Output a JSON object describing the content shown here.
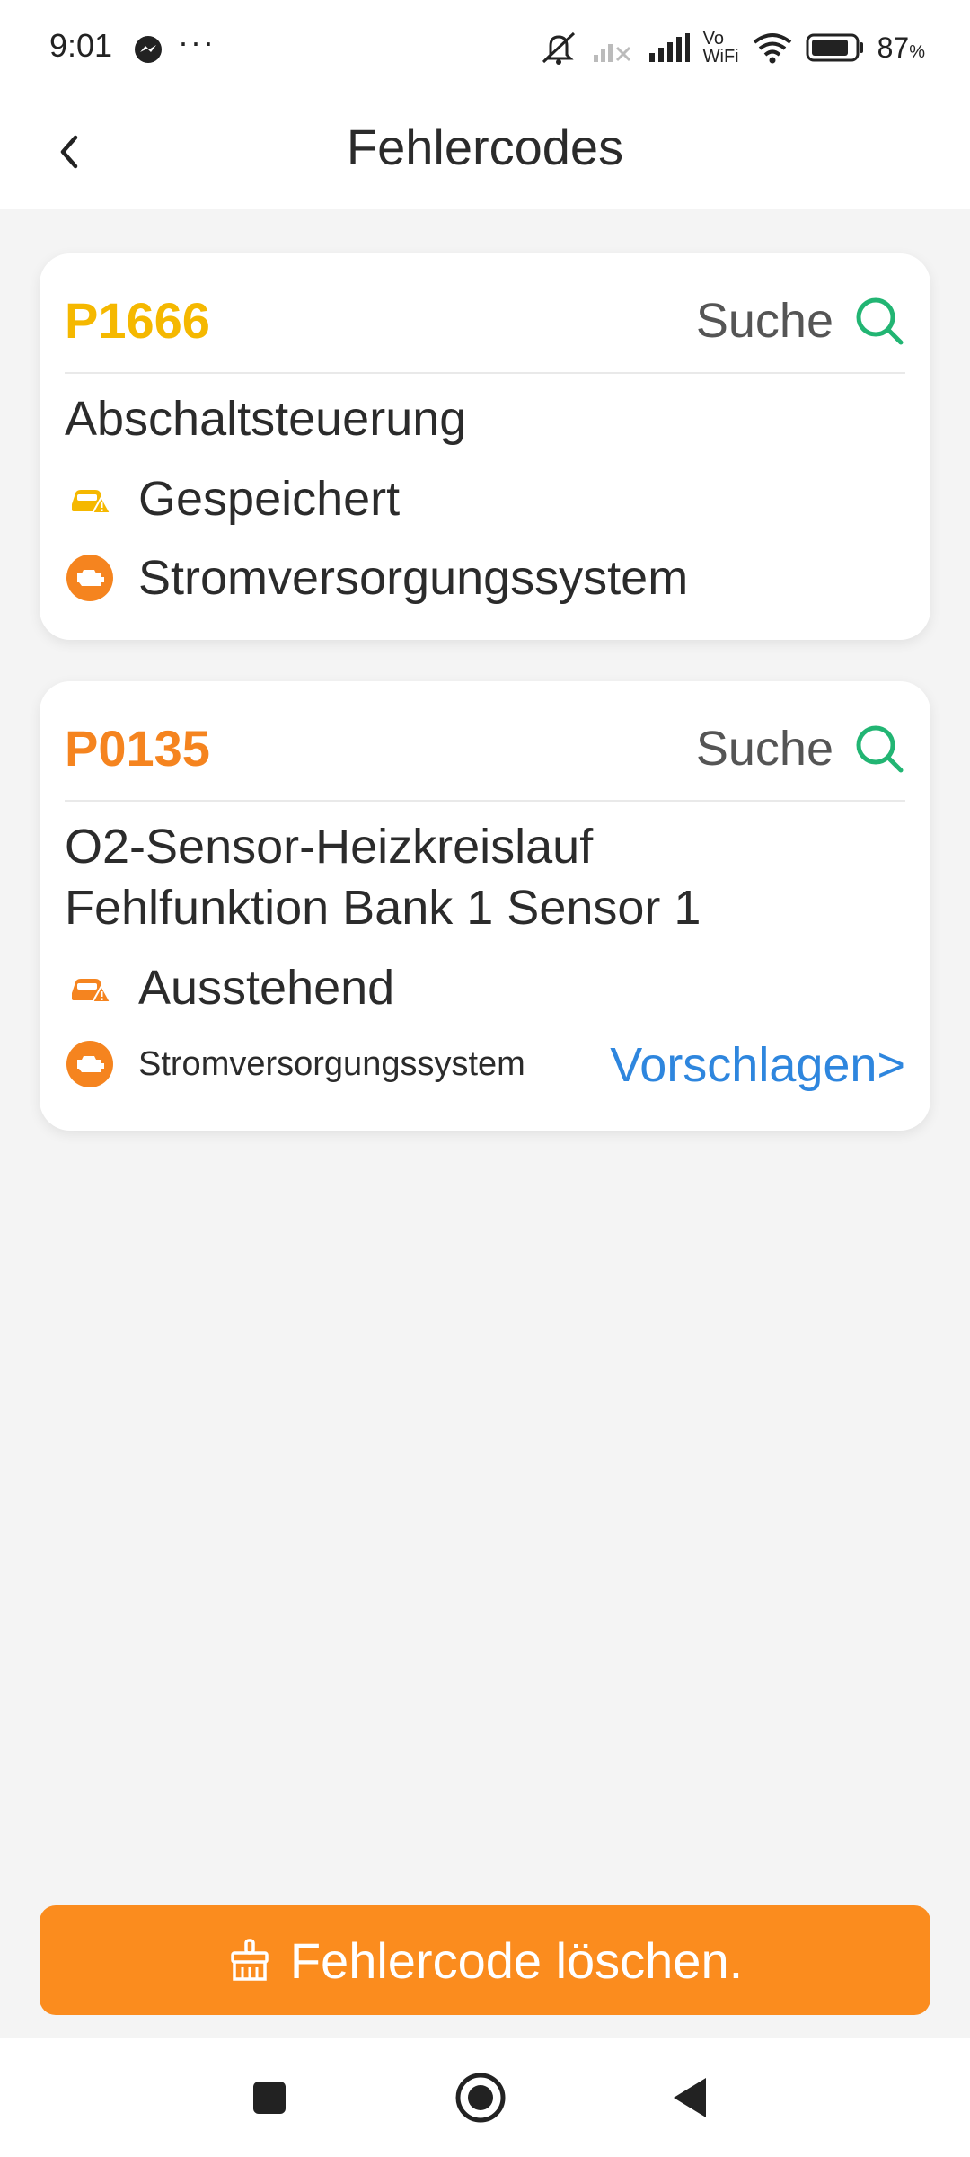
{
  "status_bar": {
    "time": "9:01",
    "more": "···",
    "network_label_top": "Vo",
    "network_label_bottom": "WiFi",
    "battery_percent": "87",
    "battery_level": 0.87,
    "icons": [
      "messenger-icon",
      "more-dots-icon",
      "mute-icon",
      "signal-x-icon",
      "signal-icon",
      "vowifi-icon",
      "wifi-icon",
      "battery-icon"
    ]
  },
  "header": {
    "title": "Fehlercodes",
    "back_icon": "chevron-left-icon"
  },
  "codes": [
    {
      "code": "P1666",
      "code_color": "#f5b800",
      "search_label": "Suche",
      "description_lines": [
        "Abschaltsteuerung"
      ],
      "status": "Gespeichert",
      "status_icon_color": "#f5b800",
      "system": "Stromversorgungssystem"
    },
    {
      "code": "P0135",
      "code_color": "#f5841f",
      "search_label": "Suche",
      "description_lines": [
        "O2-Sensor-Heizkreislauf",
        "Fehlfunktion Bank 1 Sensor 1"
      ],
      "status": "Ausstehend",
      "status_icon_color": "#f5841f",
      "system": "Stromversorgungssystem",
      "suggest_label": "Vorschlagen>"
    }
  ],
  "clear_button": {
    "label": "Fehlercode löschen.",
    "icon": "broom-icon"
  },
  "colors": {
    "accent_orange": "#fb8c1e",
    "search_green": "#22b573",
    "link_blue": "#2e86de"
  },
  "nav_bar": {
    "icons": [
      "recents-square-icon",
      "home-circle-icon",
      "back-triangle-icon"
    ]
  }
}
